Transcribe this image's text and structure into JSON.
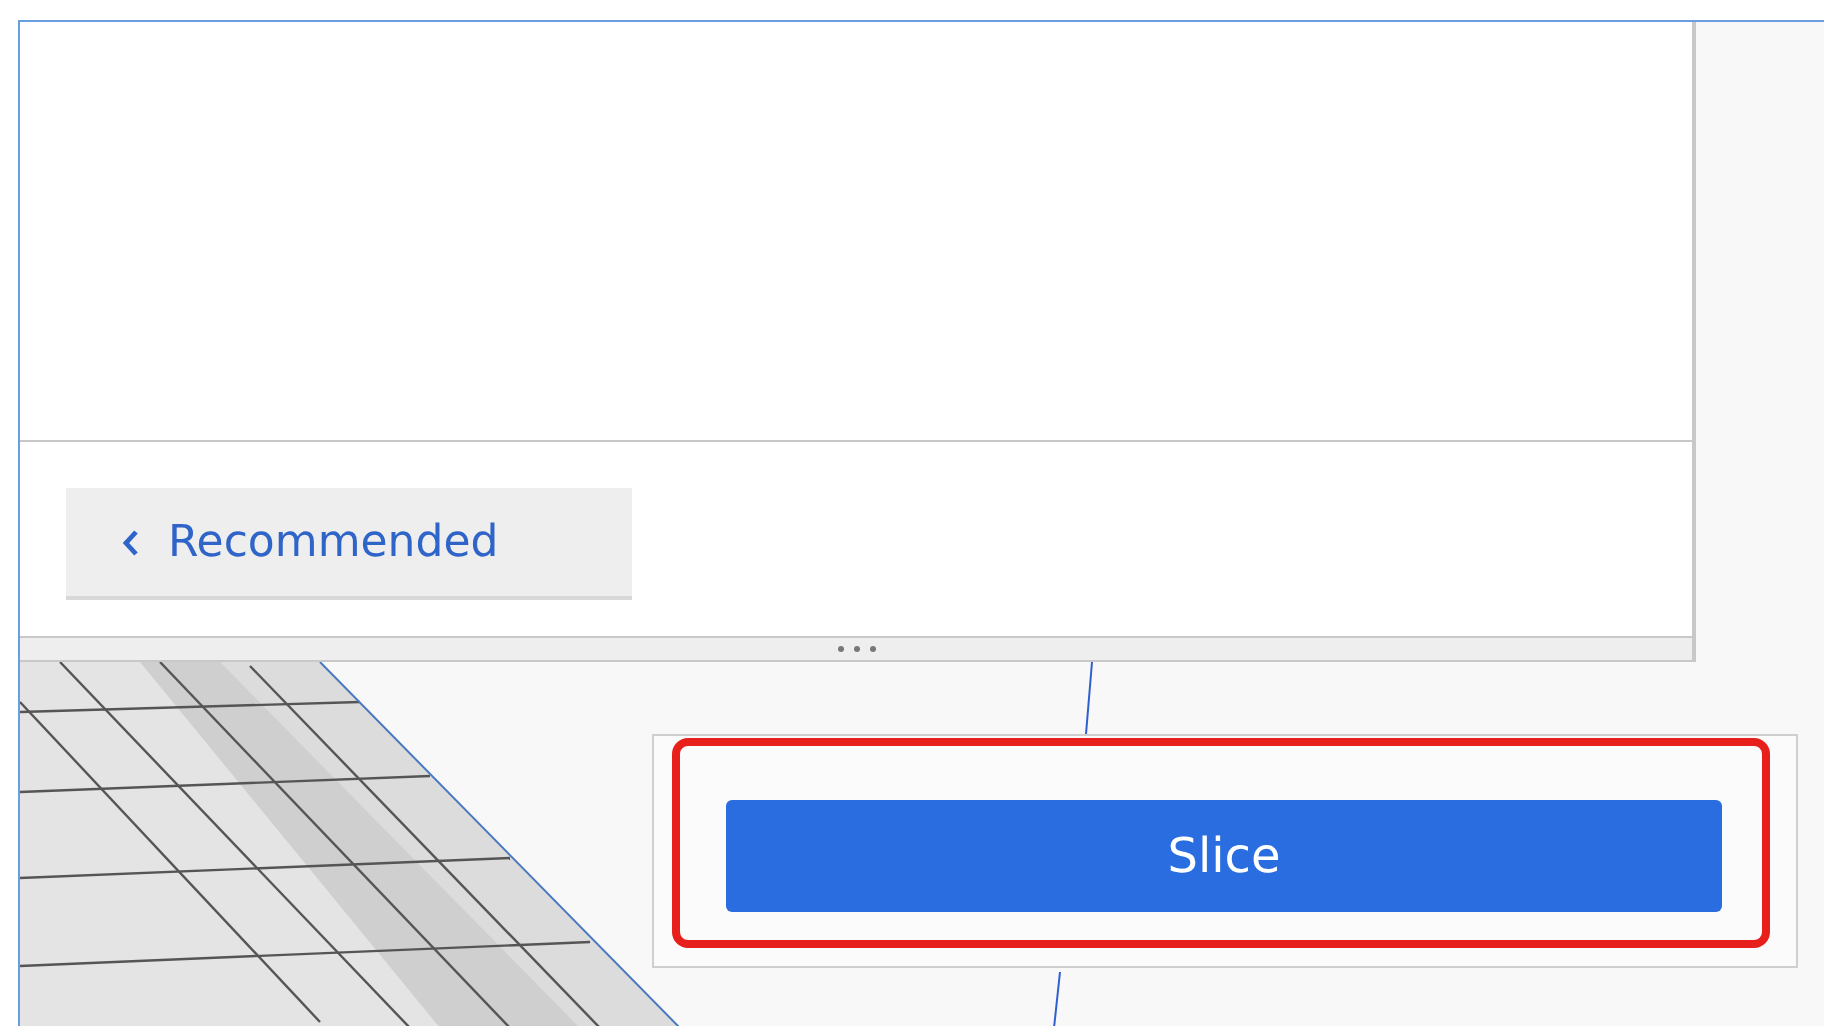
{
  "settings_panel": {
    "back_button": {
      "label": "Recommended"
    }
  },
  "slice_panel": {
    "slice_button": {
      "label": "Slice",
      "highlighted": true
    }
  }
}
